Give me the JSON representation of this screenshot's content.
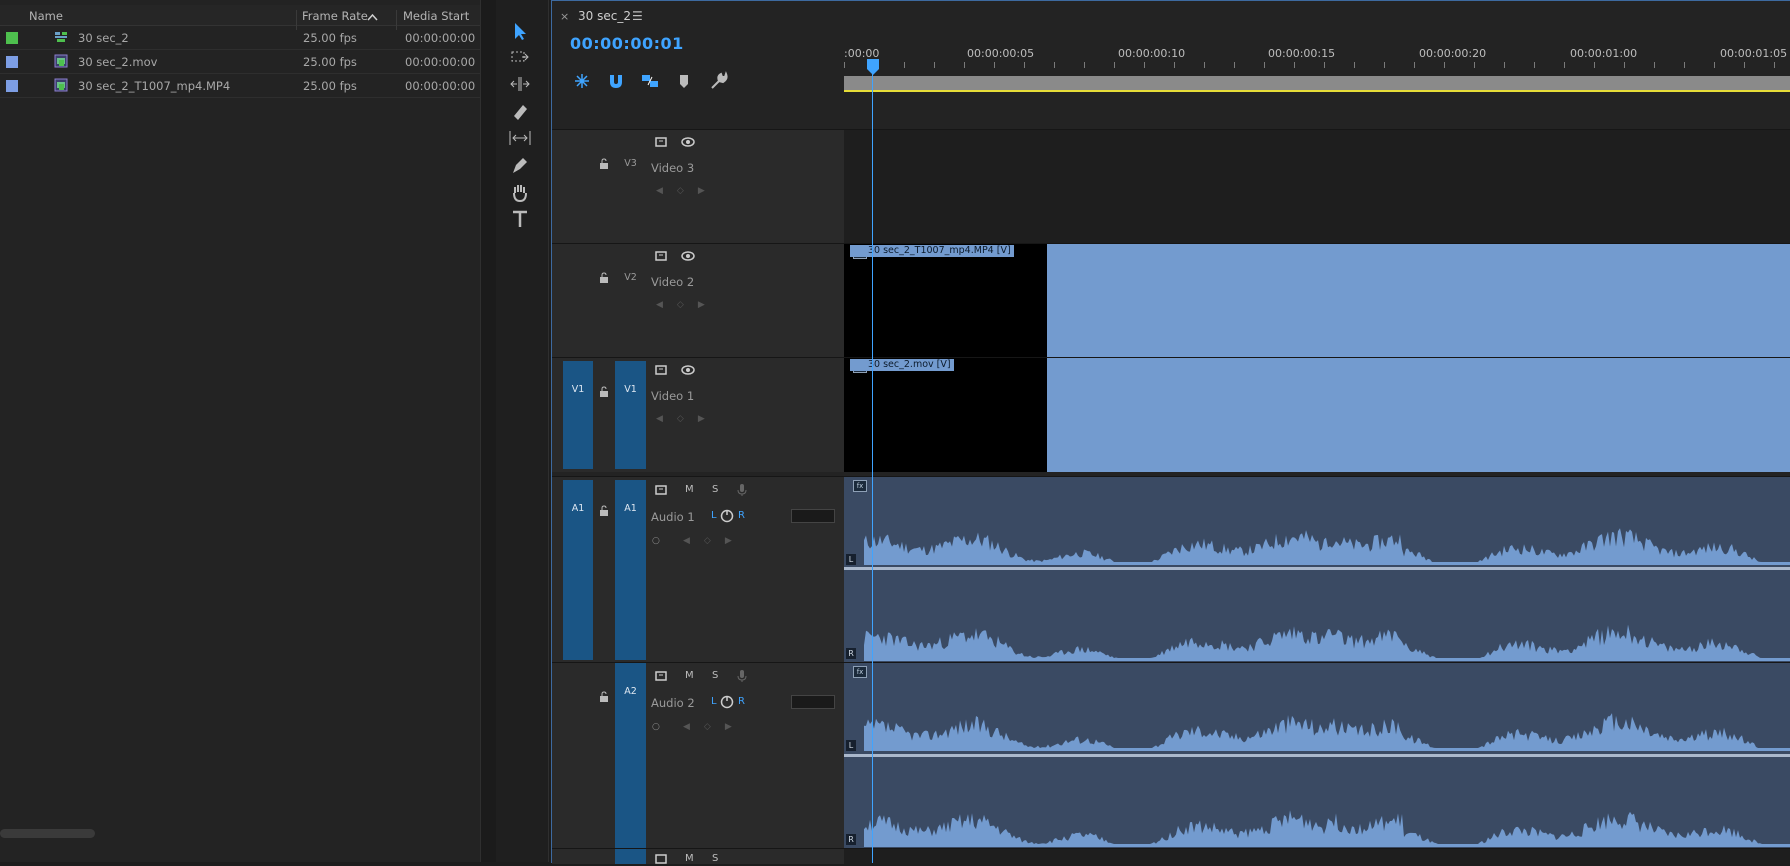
{
  "project": {
    "columns": {
      "name": "Name",
      "frame_rate": "Frame Rate",
      "media_start": "Media Start"
    },
    "items": [
      {
        "label_color": "#4ec04e",
        "icon": "sequence-icon",
        "name": "30 sec_2",
        "frame_rate": "25.00 fps",
        "media_start": "00:00:00:00"
      },
      {
        "label_color": "#7d9ee4",
        "icon": "video-clip-icon",
        "name": "30 sec_2.mov",
        "frame_rate": "25.00 fps",
        "media_start": "00:00:00:00"
      },
      {
        "label_color": "#7d9ee4",
        "icon": "video-clip-icon",
        "name": "30 sec_2_T1007_mp4.MP4",
        "frame_rate": "25.00 fps",
        "media_start": "00:00:00:00"
      }
    ]
  },
  "timeline": {
    "tab_close": "×",
    "sequence_name": "30 sec_2",
    "tab_menu": "☰",
    "timecode": "00:00:00:01",
    "ruler": [
      ":00:00",
      "00:00:00:05",
      "00:00:00:10",
      "00:00:00:15",
      "00:00:00:20",
      "00:00:01:00",
      "00:00:01:05"
    ],
    "tracks": {
      "v3": {
        "id": "V3",
        "name": "Video 3"
      },
      "v2": {
        "id": "V2",
        "name": "Video 2",
        "clip": "30 sec_2_T1007_mp4.MP4 [V]"
      },
      "v1": {
        "src": "V1",
        "id": "V1",
        "name": "Video 1",
        "clip": "30 sec_2.mov [V]"
      },
      "a1": {
        "src": "A1",
        "id": "A1",
        "name": "Audio 1",
        "m": "M",
        "s": "S",
        "l": "L",
        "r": "R"
      },
      "a2": {
        "id": "A2",
        "name": "Audio 2",
        "m": "M",
        "s": "S",
        "l": "L",
        "r": "R"
      },
      "a3": {
        "m": "M",
        "s": "S"
      }
    },
    "channel_l": "L",
    "channel_r": "R",
    "fx": "fx"
  },
  "colors": {
    "accent": "#3fa4ff",
    "clip": "#739bcf",
    "audio_bg": "#3a4a63",
    "patch": "#1a5585",
    "work_area": "#e6dd38"
  }
}
